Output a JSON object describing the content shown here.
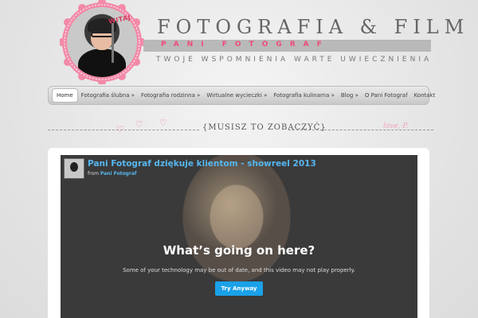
{
  "header": {
    "badge_tag": "WITAJ",
    "title": "FOTOGRAFIA & FILM",
    "subtitle": "PANI FOTOGRAF",
    "tagline": "TWOJE WSPOMNIENIA WARTE UWIECZNIENIA"
  },
  "nav": {
    "items": [
      {
        "label": "Home"
      },
      {
        "label": "Fotografia ślubna »"
      },
      {
        "label": "Fotografia rodzinna »"
      },
      {
        "label": "Wirtualne wycieczki »"
      },
      {
        "label": "Fotografia kulinarna »"
      },
      {
        "label": "Blog »"
      },
      {
        "label": "O Pani Fotograf"
      },
      {
        "label": "Kontakt"
      }
    ]
  },
  "divider": {
    "label": "{MUSISZ TO ZOBACZYĆ}",
    "signature": "love, P."
  },
  "video": {
    "title": "Pani Fotograf dziękuje klientom - showreel 2013",
    "from_label": "from",
    "author": "Pani Fotograf",
    "message_title": "What’s going on here?",
    "message_text": "Some of your technology may be out of date, and this video may not play properly.",
    "button_label": "Try Anyway"
  },
  "colors": {
    "accent_pink": "#f04a7a",
    "link_blue": "#56b7f0",
    "button_blue": "#1aa1e8"
  }
}
